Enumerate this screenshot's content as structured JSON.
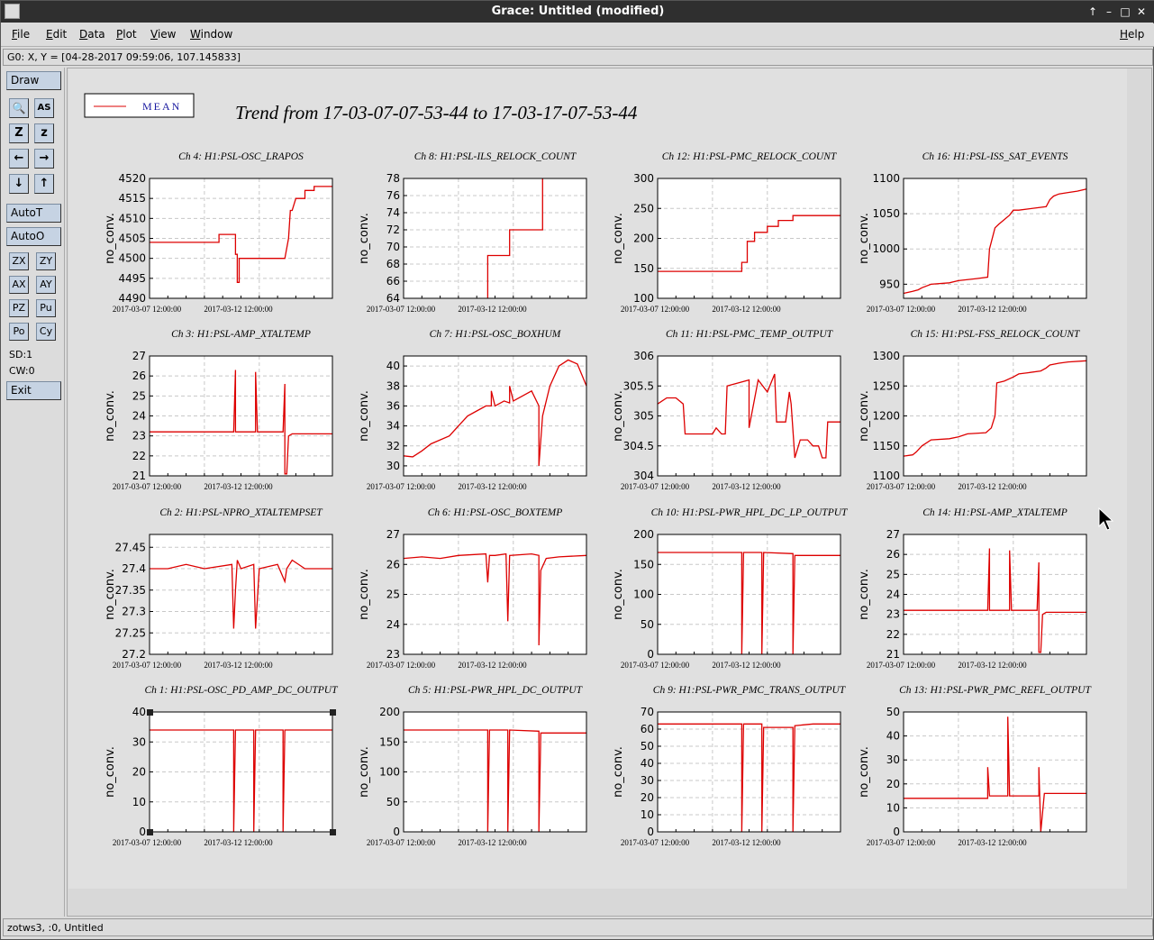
{
  "window": {
    "title": "Grace: Untitled (modified)",
    "controls": [
      "↑",
      "–",
      "□",
      "✕"
    ]
  },
  "menu": {
    "file": "File",
    "edit": "Edit",
    "data": "Data",
    "plot": "Plot",
    "view": "View",
    "window": "Window",
    "help": "Help"
  },
  "locator": "G0: X, Y = [04-28-2017 09:59:06, 107.145833]",
  "tools": {
    "draw": "Draw",
    "autot": "AutoT",
    "autoo": "AutoO",
    "zx": "ZX",
    "zy": "ZY",
    "ax": "AX",
    "ay": "AY",
    "pz": "PZ",
    "pu": "Pu",
    "po": "Po",
    "cy": "Cy",
    "sd": "SD:1",
    "cw": "CW:0",
    "exit": "Exit",
    "icons": {
      "zoom": "🔍",
      "as": "AS",
      "bigz": "Z",
      "smallz": "z",
      "left": "←",
      "right": "→",
      "down": "↓",
      "up": "↑"
    }
  },
  "status": "zotws3, :0, Untitled",
  "legend": {
    "label": "MEAN"
  },
  "page_title": "Trend from 17-03-07-07-53-44 to 17-03-17-07-53-44",
  "colors": {
    "series": "#dd0000",
    "grid": "#c8c8c8",
    "legend_text": "#1a1aa0"
  },
  "chart_data": [
    {
      "title": "Ch 4: H1:PSL-OSC_LRAPOS",
      "ylabel": "no_conv.",
      "yticks": [
        "4520",
        "4515",
        "4510",
        "4505",
        "4500",
        "4495",
        "4490"
      ],
      "ylim": [
        4490,
        4520
      ],
      "xticks": [
        "2017-03-07 12:00:00",
        "2017-03-12 12:00:00"
      ],
      "x": [
        0,
        0.38,
        0.38,
        0.47,
        0.47,
        0.48,
        0.48,
        0.49,
        0.49,
        0.53,
        0.53,
        0.68,
        0.74,
        0.76,
        0.77,
        0.78,
        0.8,
        0.85,
        0.85,
        0.9,
        0.9,
        1.0
      ],
      "y": [
        4504,
        4504,
        4506,
        4506,
        4501,
        4501,
        4494,
        4494,
        4500,
        4500,
        4500,
        4500,
        4500,
        4505,
        4512,
        4512,
        4515,
        4515,
        4517,
        4517,
        4518,
        4518
      ]
    },
    {
      "title": "Ch 8: H1:PSL-ILS_RELOCK_COUNT",
      "ylabel": "no_conv.",
      "yticks": [
        "78",
        "76",
        "74",
        "72",
        "70",
        "68",
        "66",
        "64"
      ],
      "ylim": [
        64,
        78
      ],
      "xticks": [
        "2017-03-07 12:00:00",
        "2017-03-12 12:00:00"
      ],
      "x": [
        0.46,
        0.46,
        0.58,
        0.58,
        0.75,
        0.75,
        0.76,
        0.76
      ],
      "y": [
        64,
        69,
        69,
        72,
        72,
        72,
        72,
        78
      ]
    },
    {
      "title": "Ch 12: H1:PSL-PMC_RELOCK_COUNT",
      "ylabel": "no_conv.",
      "yticks": [
        "300",
        "250",
        "200",
        "150",
        "100"
      ],
      "ylim": [
        100,
        300
      ],
      "xticks": [
        "2017-03-07 12:00:00",
        "2017-03-12 12:00:00"
      ],
      "x": [
        0,
        0.46,
        0.46,
        0.49,
        0.49,
        0.53,
        0.53,
        0.6,
        0.6,
        0.66,
        0.66,
        0.74,
        0.74,
        1.0
      ],
      "y": [
        145,
        145,
        160,
        160,
        195,
        195,
        210,
        210,
        220,
        220,
        230,
        230,
        238,
        238
      ]
    },
    {
      "title": "Ch 16: H1:PSL-ISS_SAT_EVENTS",
      "ylabel": "no_conv.",
      "yticks": [
        "1100",
        "1050",
        "1000",
        "950"
      ],
      "ylim": [
        930,
        1100
      ],
      "xticks": [
        "2017-03-07 12:00:00",
        "2017-03-12 12:00:00"
      ],
      "x": [
        0,
        0.05,
        0.08,
        0.1,
        0.15,
        0.25,
        0.3,
        0.4,
        0.46,
        0.47,
        0.5,
        0.52,
        0.58,
        0.6,
        0.63,
        0.78,
        0.8,
        0.82,
        0.85,
        0.9,
        0.95,
        1.0
      ],
      "y": [
        937,
        940,
        942,
        945,
        950,
        952,
        955,
        958,
        960,
        1000,
        1030,
        1035,
        1048,
        1055,
        1055,
        1060,
        1070,
        1075,
        1078,
        1080,
        1082,
        1085
      ]
    },
    {
      "title": "Ch 3: H1:PSL-AMP_XTALTEMP",
      "ylabel": "no_conv.",
      "yticks": [
        "27",
        "26",
        "25",
        "24",
        "23",
        "22",
        "21"
      ],
      "ylim": [
        21,
        27
      ],
      "xticks": [
        "2017-03-07 12:00:00",
        "2017-03-12 12:00:00"
      ],
      "x": [
        0,
        0.46,
        0.47,
        0.47,
        0.48,
        0.58,
        0.58,
        0.59,
        0.73,
        0.74,
        0.74,
        0.75,
        0.76,
        0.78,
        1.0
      ],
      "y": [
        23.2,
        23.2,
        26.3,
        23.2,
        23.2,
        23.2,
        26.2,
        23.2,
        23.2,
        25.6,
        21.1,
        21.1,
        23.0,
        23.1,
        23.1
      ]
    },
    {
      "title": "Ch 7: H1:PSL-OSC_BOXHUM",
      "ylabel": "no_conv.",
      "yticks": [
        "40",
        "38",
        "36",
        "34",
        "32",
        "30"
      ],
      "ylim": [
        29,
        41
      ],
      "xticks": [
        "2017-03-07 12:00:00",
        "2017-03-12 12:00:00"
      ],
      "x": [
        0,
        0.05,
        0.1,
        0.15,
        0.25,
        0.3,
        0.35,
        0.4,
        0.45,
        0.48,
        0.48,
        0.5,
        0.55,
        0.58,
        0.58,
        0.6,
        0.7,
        0.74,
        0.74,
        0.76,
        0.8,
        0.85,
        0.9,
        0.95,
        1.0
      ],
      "y": [
        31,
        30.9,
        31.5,
        32.2,
        33,
        34,
        35,
        35.5,
        36,
        36,
        37.5,
        36,
        36.5,
        36.3,
        38,
        36.5,
        37.5,
        36,
        30,
        35,
        38,
        40,
        40.6,
        40.2,
        38
      ]
    },
    {
      "title": "Ch 11: H1:PSL-PMC_TEMP_OUTPUT",
      "ylabel": "no_conv.",
      "yticks": [
        "306",
        "305.5",
        "305",
        "304.5",
        "304"
      ],
      "ylim": [
        304,
        306
      ],
      "xticks": [
        "2017-03-07 12:00:00",
        "2017-03-12 12:00:00"
      ],
      "x": [
        0,
        0.05,
        0.1,
        0.14,
        0.15,
        0.3,
        0.32,
        0.35,
        0.37,
        0.38,
        0.5,
        0.5,
        0.55,
        0.6,
        0.64,
        0.65,
        0.7,
        0.72,
        0.73,
        0.75,
        0.78,
        0.82,
        0.85,
        0.88,
        0.9,
        0.92,
        0.93,
        1.0
      ],
      "y": [
        305.2,
        305.3,
        305.3,
        305.2,
        304.7,
        304.7,
        304.8,
        304.7,
        304.7,
        305.5,
        305.6,
        304.8,
        305.6,
        305.4,
        305.7,
        304.9,
        304.9,
        305.4,
        305.2,
        304.3,
        304.6,
        304.6,
        304.5,
        304.5,
        304.3,
        304.3,
        304.9,
        304.9
      ]
    },
    {
      "title": "Ch 15: H1:PSL-FSS_RELOCK_COUNT",
      "ylabel": "no_conv.",
      "yticks": [
        "1300",
        "1250",
        "1200",
        "1150",
        "1100"
      ],
      "ylim": [
        1100,
        1300
      ],
      "xticks": [
        "2017-03-07 12:00:00",
        "2017-03-12 12:00:00"
      ],
      "x": [
        0,
        0.05,
        0.07,
        0.1,
        0.15,
        0.25,
        0.3,
        0.35,
        0.45,
        0.48,
        0.5,
        0.51,
        0.55,
        0.6,
        0.63,
        0.68,
        0.75,
        0.78,
        0.8,
        0.85,
        0.9,
        1.0
      ],
      "y": [
        1133,
        1135,
        1140,
        1150,
        1160,
        1162,
        1165,
        1170,
        1172,
        1180,
        1200,
        1255,
        1258,
        1265,
        1270,
        1272,
        1275,
        1280,
        1285,
        1288,
        1290,
        1292
      ]
    },
    {
      "title": "Ch 2: H1:PSL-NPRO_XTALTEMPSET",
      "ylabel": "no_conv.",
      "yticks": [
        "27.45",
        "27.4",
        "27.35",
        "27.3",
        "27.25",
        "27.2"
      ],
      "ylim": [
        27.2,
        27.48
      ],
      "xticks": [
        "2017-03-07 12:00:00",
        "2017-03-12 12:00:00"
      ],
      "x": [
        0,
        0.1,
        0.2,
        0.3,
        0.45,
        0.46,
        0.47,
        0.48,
        0.5,
        0.57,
        0.58,
        0.6,
        0.7,
        0.74,
        0.75,
        0.78,
        0.85,
        1.0
      ],
      "y": [
        27.4,
        27.4,
        27.41,
        27.4,
        27.41,
        27.26,
        27.35,
        27.42,
        27.4,
        27.41,
        27.26,
        27.4,
        27.41,
        27.37,
        27.4,
        27.42,
        27.4,
        27.4
      ]
    },
    {
      "title": "Ch 6: H1:PSL-OSC_BOXTEMP",
      "ylabel": "no_conv.",
      "yticks": [
        "27",
        "26",
        "25",
        "24",
        "23"
      ],
      "ylim": [
        23,
        27
      ],
      "xticks": [
        "2017-03-07 12:00:00",
        "2017-03-12 12:00:00"
      ],
      "x": [
        0,
        0.1,
        0.2,
        0.3,
        0.45,
        0.46,
        0.47,
        0.5,
        0.56,
        0.57,
        0.58,
        0.7,
        0.74,
        0.74,
        0.75,
        0.78,
        0.85,
        1.0
      ],
      "y": [
        26.2,
        26.25,
        26.2,
        26.3,
        26.35,
        25.4,
        26.3,
        26.3,
        26.35,
        24.1,
        26.3,
        26.35,
        26.3,
        23.3,
        25.8,
        26.2,
        26.25,
        26.3
      ]
    },
    {
      "title": "Ch 10: H1:PSL-PWR_HPL_DC_LP_OUTPUT",
      "ylabel": "no_conv.",
      "yticks": [
        "200",
        "150",
        "100",
        "50",
        "0"
      ],
      "ylim": [
        0,
        200
      ],
      "xticks": [
        "2017-03-07 12:00:00",
        "2017-03-12 12:00:00"
      ],
      "x": [
        0,
        0.46,
        0.46,
        0.47,
        0.57,
        0.57,
        0.58,
        0.74,
        0.74,
        0.75,
        1.0
      ],
      "y": [
        170,
        170,
        0,
        170,
        170,
        0,
        170,
        168,
        0,
        165,
        165
      ]
    },
    {
      "title": "Ch 14: H1:PSL-AMP_XTALTEMP",
      "ylabel": "no_conv.",
      "yticks": [
        "27",
        "26",
        "25",
        "24",
        "23",
        "22",
        "21"
      ],
      "ylim": [
        21,
        27
      ],
      "xticks": [
        "2017-03-07 12:00:00",
        "2017-03-12 12:00:00"
      ],
      "x": [
        0,
        0.46,
        0.47,
        0.47,
        0.48,
        0.58,
        0.58,
        0.59,
        0.73,
        0.74,
        0.74,
        0.75,
        0.76,
        0.78,
        1.0
      ],
      "y": [
        23.2,
        23.2,
        26.3,
        23.2,
        23.2,
        23.2,
        26.2,
        23.2,
        23.2,
        25.6,
        21.1,
        21.1,
        23.0,
        23.1,
        23.1
      ]
    },
    {
      "title": "Ch 1: H1:PSL-OSC_PD_AMP_DC_OUTPUT",
      "ylabel": "no_conv.",
      "yticks": [
        "40",
        "30",
        "20",
        "10",
        "0"
      ],
      "ylim": [
        0,
        40
      ],
      "xticks": [
        "2017-03-07 12:00:00",
        "2017-03-12 12:00:00"
      ],
      "x": [
        0,
        0.46,
        0.46,
        0.47,
        0.57,
        0.57,
        0.58,
        0.73,
        0.73,
        0.74,
        1.0
      ],
      "y": [
        34,
        34,
        0,
        34,
        34,
        0,
        34,
        34,
        0,
        34,
        34
      ]
    },
    {
      "title": "Ch 5: H1:PSL-PWR_HPL_DC_OUTPUT",
      "ylabel": "no_conv.",
      "yticks": [
        "200",
        "150",
        "100",
        "50",
        "0"
      ],
      "ylim": [
        0,
        200
      ],
      "xticks": [
        "2017-03-07 12:00:00",
        "2017-03-12 12:00:00"
      ],
      "x": [
        0,
        0.46,
        0.46,
        0.47,
        0.57,
        0.57,
        0.58,
        0.74,
        0.74,
        0.75,
        1.0
      ],
      "y": [
        170,
        170,
        0,
        170,
        170,
        0,
        170,
        168,
        0,
        165,
        165
      ]
    },
    {
      "title": "Ch 9: H1:PSL-PWR_PMC_TRANS_OUTPUT",
      "ylabel": "no_conv.",
      "yticks": [
        "70",
        "60",
        "50",
        "40",
        "30",
        "20",
        "10",
        "0"
      ],
      "ylim": [
        0,
        70
      ],
      "xticks": [
        "2017-03-07 12:00:00",
        "2017-03-12 12:00:00"
      ],
      "x": [
        0,
        0.2,
        0.46,
        0.46,
        0.47,
        0.57,
        0.57,
        0.58,
        0.6,
        0.74,
        0.74,
        0.75,
        0.85,
        1.0
      ],
      "y": [
        63,
        63,
        63,
        0,
        63,
        63,
        0,
        61,
        61,
        61,
        0,
        62,
        63,
        63
      ]
    },
    {
      "title": "Ch 13: H1:PSL-PWR_PMC_REFL_OUTPUT",
      "ylabel": "no_conv.",
      "yticks": [
        "50",
        "40",
        "30",
        "20",
        "10",
        "0"
      ],
      "ylim": [
        0,
        50
      ],
      "xticks": [
        "2017-03-07 12:00:00",
        "2017-03-12 12:00:00"
      ],
      "x": [
        0,
        0.46,
        0.46,
        0.47,
        0.57,
        0.57,
        0.58,
        0.74,
        0.74,
        0.75,
        0.77,
        1.0
      ],
      "y": [
        14,
        14,
        27,
        15,
        15,
        48,
        15,
        15,
        27,
        0,
        16,
        16
      ]
    }
  ]
}
